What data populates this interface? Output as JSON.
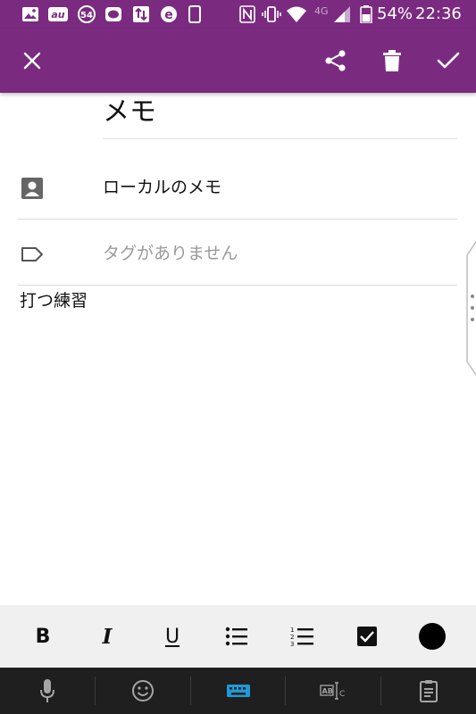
{
  "status_bar": {
    "battery_percent": "54%",
    "time": "22:36",
    "network": "4G",
    "notification_badge": "54",
    "icons": [
      "gallery-icon",
      "au-icon",
      "badge-54-icon",
      "line-icon",
      "transfer-icon",
      "e-icon",
      "phone-icon",
      "nfc-icon",
      "vibrate-icon",
      "wifi-icon",
      "signal-icon",
      "battery-icon"
    ]
  },
  "app_bar": {
    "icons": [
      "close-icon",
      "share-icon",
      "trash-icon",
      "check-icon"
    ]
  },
  "note": {
    "title": "メモ",
    "account_label": "ローカルのメモ",
    "tags_placeholder": "タグがありません",
    "body": "打つ練習"
  },
  "format_toolbar": {
    "bold_label": "B",
    "italic_label": "I",
    "underline_label": "U",
    "icons": [
      "bold-icon",
      "italic-icon",
      "underline-icon",
      "bullet-list-icon",
      "numbered-list-icon",
      "checkbox-icon",
      "color-icon"
    ],
    "color_value": "#000000"
  },
  "keyboard_bar": {
    "icons": [
      "microphone-icon",
      "emoji-icon",
      "keyboard-icon",
      "text-select-icon",
      "clipboard-icon"
    ],
    "active_color": "#1e9ad6",
    "text_select_label": "AB"
  },
  "colors": {
    "brand": "#7a2b80",
    "toolbar_bg": "#f0f0f0",
    "keyboard_bg": "#1f1f1f"
  }
}
